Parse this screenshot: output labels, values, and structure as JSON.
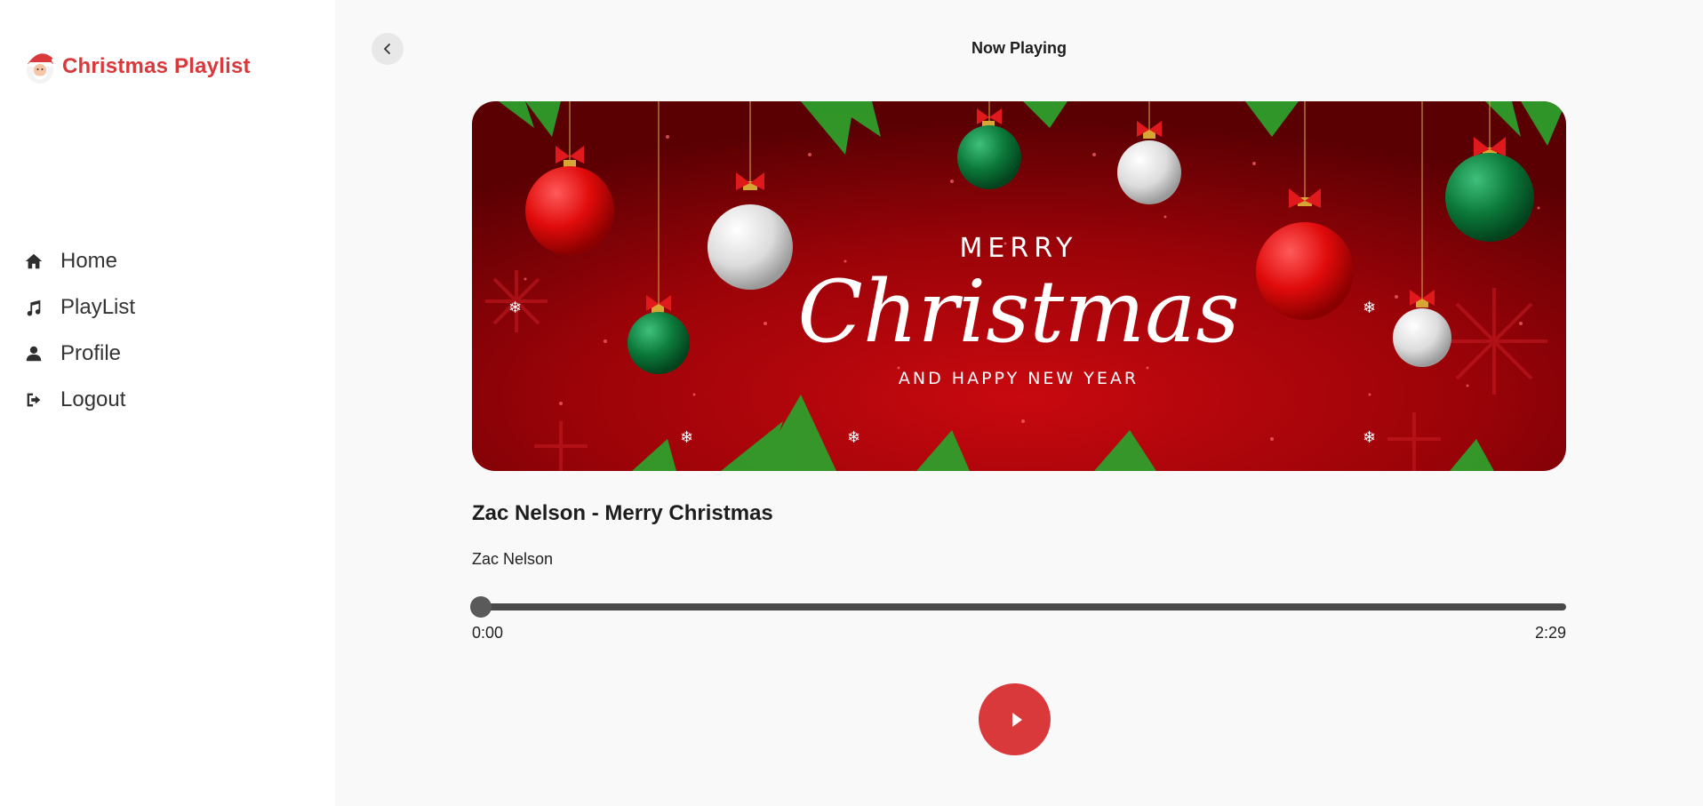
{
  "app": {
    "brand_name": "Christmas Playlist",
    "brand_icon": "santa-icon",
    "accent_color": "#d9393b"
  },
  "sidebar": {
    "items": [
      {
        "label": "Home",
        "icon": "home-icon"
      },
      {
        "label": "PlayList",
        "icon": "music-note-icon"
      },
      {
        "label": "Profile",
        "icon": "user-icon"
      },
      {
        "label": "Logout",
        "icon": "logout-icon"
      }
    ]
  },
  "header": {
    "title": "Now Playing",
    "back_icon": "chevron-left-icon"
  },
  "cover": {
    "line1": "MERRY",
    "line2": "Christmas",
    "line3": "AND HAPPY NEW YEAR"
  },
  "track": {
    "title": "Zac Nelson - Merry Christmas",
    "artist": "Zac Nelson",
    "current_time": "0:00",
    "total_time": "2:29",
    "progress": 0
  },
  "controls": {
    "play_icon": "play-icon"
  }
}
